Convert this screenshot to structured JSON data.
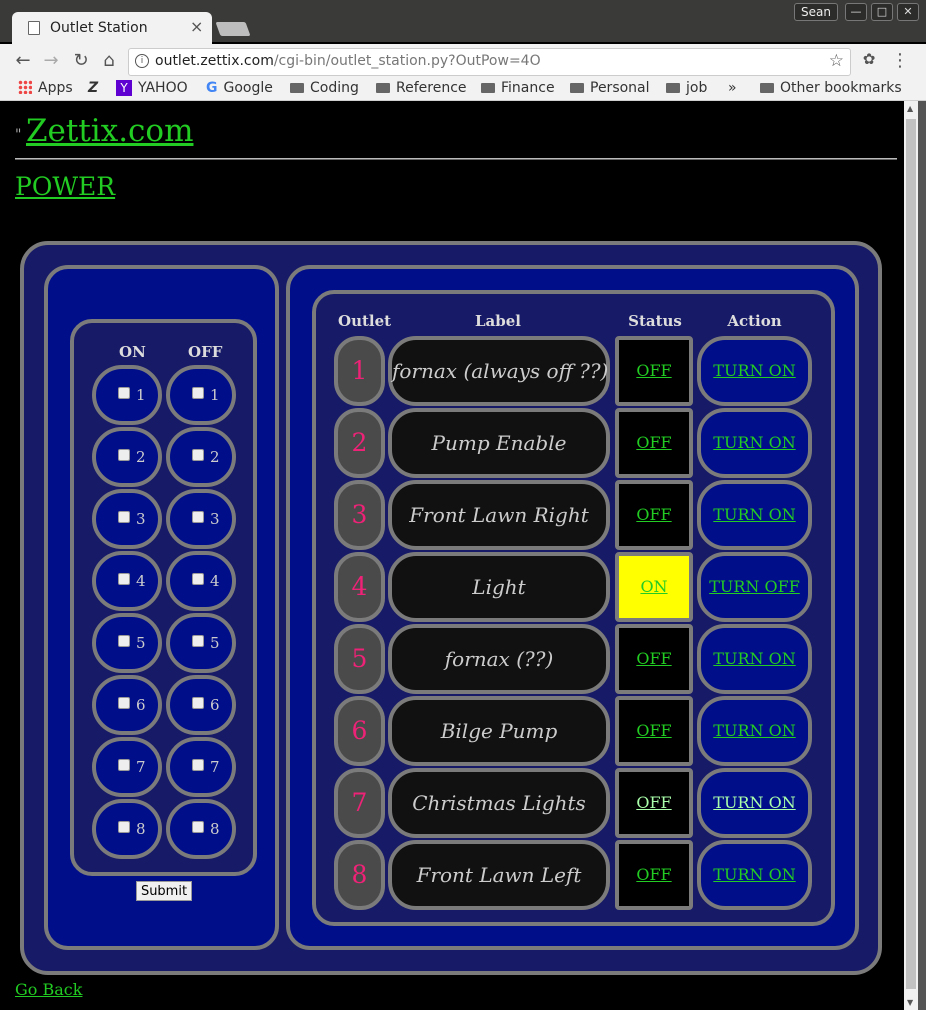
{
  "browser": {
    "tab_title": "Outlet Station",
    "user_name": "Sean",
    "url_host": "outlet.zettix.com",
    "url_path": "/cgi-bin/outlet_station.py?OutPow=4O",
    "bookmarks": [
      {
        "label": "Apps",
        "icon": "apps-grid-icon"
      },
      {
        "label": "",
        "icon": "z-logo-icon"
      },
      {
        "label": "YAHOO",
        "icon": "yahoo-icon"
      },
      {
        "label": "Google",
        "icon": "google-icon"
      },
      {
        "label": "Coding",
        "icon": "folder-icon"
      },
      {
        "label": "Reference",
        "icon": "folder-icon"
      },
      {
        "label": "Finance",
        "icon": "folder-icon"
      },
      {
        "label": "Personal",
        "icon": "folder-icon"
      },
      {
        "label": "job",
        "icon": "folder-icon"
      }
    ],
    "overflow": "»",
    "other_bookmarks": "Other bookmarks"
  },
  "page": {
    "quote_mark": "\"",
    "site_link": "Zettix.com",
    "power_link": "POWER",
    "go_back": "Go Back",
    "on_header": "ON",
    "off_header": "OFF",
    "submit_label": "Submit",
    "checkbox_numbers": [
      "1",
      "2",
      "3",
      "4",
      "5",
      "6",
      "7",
      "8"
    ],
    "table_headers": {
      "outlet": "Outlet",
      "label": "Label",
      "status": "Status",
      "action": "Action"
    },
    "outlets": [
      {
        "num": "1",
        "label": "fornax (always off ??)",
        "status": "OFF",
        "action": "TURN ON"
      },
      {
        "num": "2",
        "label": "Pump Enable",
        "status": "OFF",
        "action": "TURN ON"
      },
      {
        "num": "3",
        "label": "Front Lawn Right",
        "status": "OFF",
        "action": "TURN ON"
      },
      {
        "num": "4",
        "label": "Light",
        "status": "ON",
        "action": "TURN OFF"
      },
      {
        "num": "5",
        "label": "fornax (??)",
        "status": "OFF",
        "action": "TURN ON"
      },
      {
        "num": "6",
        "label": "Bilge Pump",
        "status": "OFF",
        "action": "TURN ON"
      },
      {
        "num": "7",
        "label": "Christmas Lights",
        "status": "OFF",
        "action": "TURN ON"
      },
      {
        "num": "8",
        "label": "Front Lawn Left",
        "status": "OFF",
        "action": "TURN ON"
      }
    ]
  },
  "colors": {
    "link": "#22cc22",
    "on_status_bg": "#ffff00",
    "outlet_number": "#ee2277",
    "panel_blue": "#000e8a",
    "border_gray": "#7b7b7b"
  }
}
